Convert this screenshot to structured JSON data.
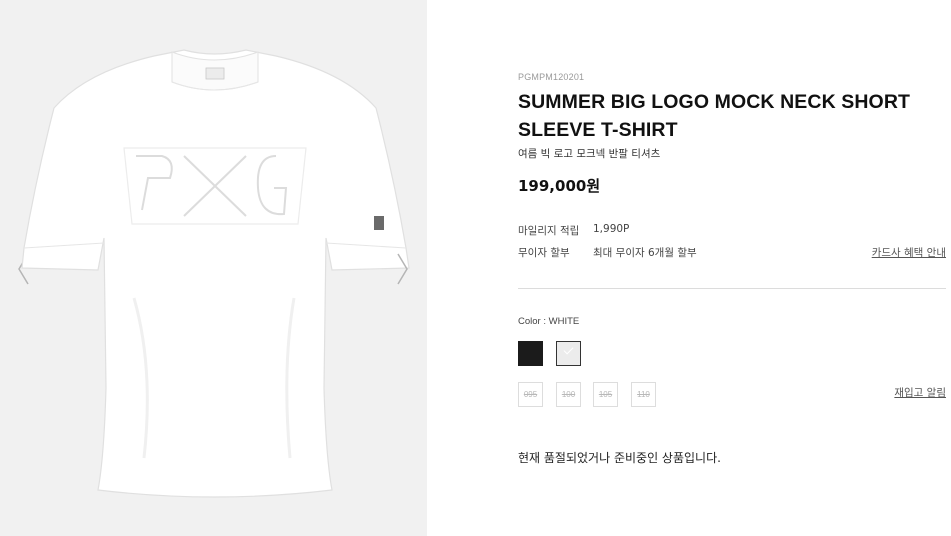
{
  "product": {
    "sku": "PGMPM120201",
    "title": "SUMMER BIG LOGO MOCK NECK SHORT SLEEVE T-SHIRT",
    "subtitle": "여름 빅 로고 모크넥 반팔 티셔츠",
    "price": "199,000원",
    "image_alt": "white mock neck t-shirt with PXG logo"
  },
  "benefits": {
    "mileage_label": "마일리지 적립",
    "mileage_value": "1,990P",
    "installment_label": "무이자 할부",
    "installment_value": "최대 무이자 6개월 할부",
    "card_link": "카드사 혜택 안내"
  },
  "options": {
    "color_label": "Color : WHITE",
    "colors": [
      {
        "name": "black",
        "hex": "#1b1b1b",
        "selected": false
      },
      {
        "name": "white",
        "hex": "#ececec",
        "selected": true
      }
    ],
    "sizes": [
      "095",
      "100",
      "105",
      "110"
    ],
    "restock_link": "재입고 알림"
  },
  "status": {
    "soldout_message": "현재 품절되었거나 준비중인 상품입니다."
  },
  "gallery": {
    "prev_icon": "chevron-left-icon",
    "next_icon": "chevron-right-icon"
  }
}
